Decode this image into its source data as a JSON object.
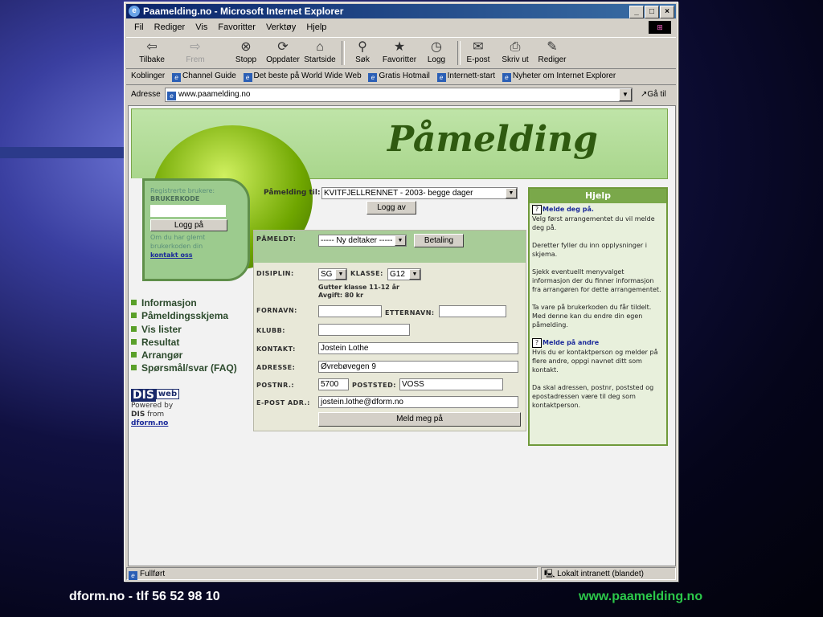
{
  "window": {
    "title": "Paamelding.no - Microsoft Internet Explorer"
  },
  "menu": [
    "Fil",
    "Rediger",
    "Vis",
    "Favoritter",
    "Verktøy",
    "Hjelp"
  ],
  "toolbar": {
    "back": "Tilbake",
    "forward": "Frem",
    "stop": "Stopp",
    "refresh": "Oppdater",
    "home": "Startside",
    "search": "Søk",
    "favorites": "Favoritter",
    "history": "Logg",
    "mail": "E-post",
    "print": "Skriv ut",
    "edit": "Rediger"
  },
  "links": {
    "label": "Koblinger",
    "items": [
      "Channel Guide",
      "Det beste på World Wide Web",
      "Gratis Hotmail",
      "Internett-start",
      "Nyheter om Internet Explorer"
    ]
  },
  "address": {
    "label": "Adresse",
    "value": "www.paamelding.no",
    "go": "Gå til"
  },
  "page": {
    "banner_title": "Påmelding",
    "login": {
      "registered": "Registrerte brukere:",
      "code_label": "BRUKERKODE",
      "button": "Logg på",
      "forgot": "Om du har glemt brukerkoden din",
      "contact_link": "kontakt oss"
    },
    "nav": [
      "Informasjon",
      "Påmeldingsskjema",
      "Vis lister",
      "Resultat",
      "Arrangør",
      "Spørsmål/svar (FAQ)"
    ],
    "powered": {
      "logo_dis": "DIS",
      "logo_web": "web",
      "line1": "Powered by",
      "line2a": "DIS",
      "line2b": "from",
      "link": "dform.no"
    },
    "pm_til_label": "Påmelding til:",
    "event_select": "KVITFJELLRENNET - 2003- begge dager",
    "logout": "Logg av",
    "form": {
      "pameldt_label": "PÅMELDT:",
      "pameldt_select": "----- Ny deltaker -----",
      "betaling": "Betaling",
      "disiplin_label": "DISIPLIN:",
      "disiplin_value": "SG",
      "klasse_label": "KLASSE:",
      "klasse_value": "G12",
      "gutter": "Gutter klasse 11-12 år",
      "avgift": "Avgift: 80 kr",
      "fornavn_label": "FORNAVN:",
      "fornavn_value": "",
      "etternavn_label": "ETTERNAVN:",
      "etternavn_value": "",
      "klubb_label": "KLUBB:",
      "klubb_value": "",
      "kontakt_label": "KONTAKT:",
      "kontakt_value": "Jostein Lothe",
      "adresse_label": "ADRESSE:",
      "adresse_value": "Øvrebøvegen 9",
      "postnr_label": "POSTNR.:",
      "postnr_value": "5700",
      "poststed_label": "POSTSTED:",
      "poststed_value": "VOSS",
      "epost_label": "E-POST ADR.:",
      "epost_value": "jostein.lothe@dform.no",
      "submit": "Meld meg på"
    },
    "help": {
      "title": "Hjelp",
      "h1": "Melde deg på.",
      "p1": "Velg først arrangementet du vil melde deg på.",
      "p2": "Deretter fyller du inn opplysninger i skjema.",
      "p3": "Sjekk eventuellt menyvalget informasjon der du finner informasjon fra arrangøren for dette arrangementet.",
      "p4": "Ta vare på brukerkoden du får tildelt. Med denne kan du endre din egen påmelding.",
      "h2": "Melde på andre",
      "p5": "Hvis du er kontaktperson og melder på flere andre, oppgi navnet ditt som kontakt.",
      "p6": "Da skal adressen, postnr, poststed og epostadressen være til deg som kontaktperson."
    }
  },
  "status": {
    "text": "Fullført",
    "zone": "Lokalt intranett (blandet)"
  },
  "footer": {
    "left": "dform.no - tlf  56 52 98 10",
    "right": "www.paamelding.no"
  }
}
